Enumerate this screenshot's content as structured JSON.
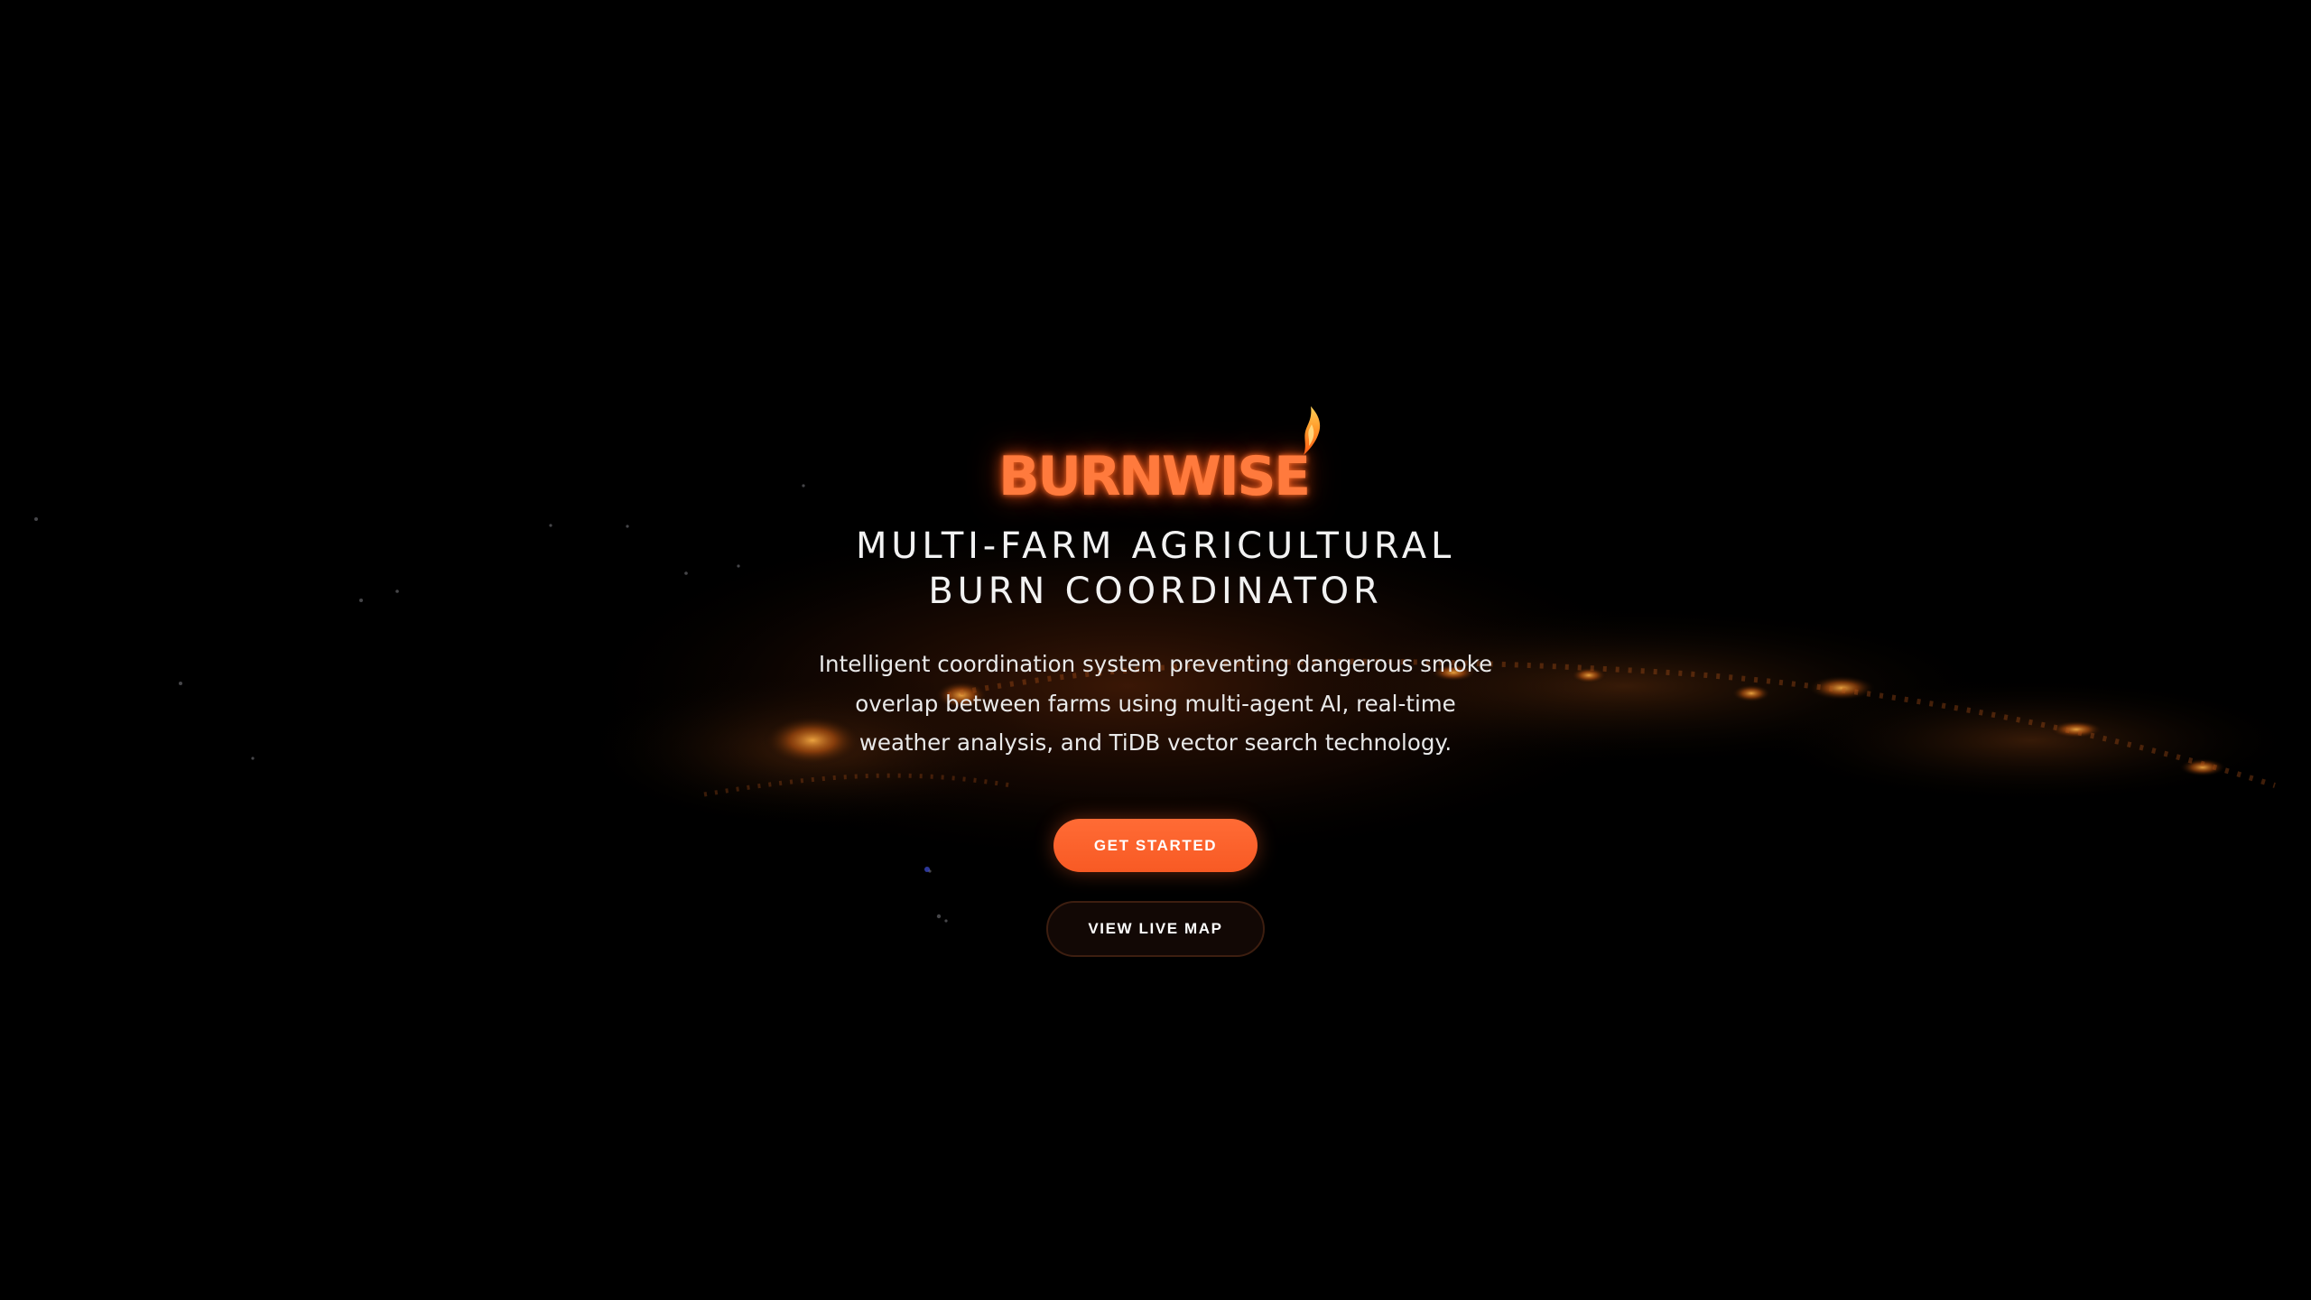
{
  "brand": {
    "name": "BURNWISE",
    "icon": "flame-icon",
    "accent_color": "#ff6b35"
  },
  "hero": {
    "tagline_lines": [
      "MULTI-FARM AGRICULTURAL",
      "BURN COORDINATOR"
    ],
    "description_lines": [
      "Intelligent coordination system preventing dangerous smoke",
      "overlap between farms using multi-agent AI, real-time",
      "weather analysis, and TiDB vector search technology."
    ]
  },
  "actions": {
    "primary_label": "GET STARTED",
    "secondary_label": "VIEW LIVE MAP"
  },
  "colors": {
    "background": "#000000",
    "primary_button": "#ff6b35",
    "secondary_button": "#120805"
  }
}
